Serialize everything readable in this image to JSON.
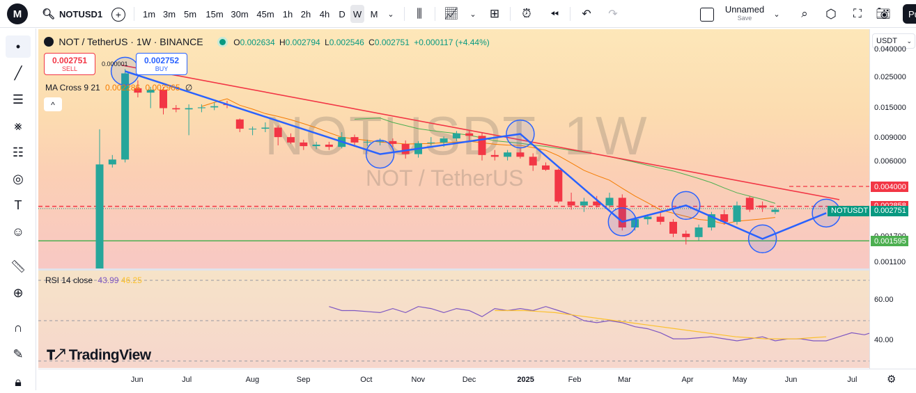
{
  "toolbar": {
    "logo": "M",
    "symbol": "NOTUSD1",
    "intervals": [
      "1m",
      "3m",
      "5m",
      "15m",
      "30m",
      "45m",
      "1h",
      "2h",
      "4h",
      "D",
      "W",
      "M"
    ],
    "active_interval": "W",
    "layout_name": "Unnamed",
    "layout_sub": "Save",
    "publish": "Pu"
  },
  "legend": {
    "title": "NOT / TetherUS · 1W · BINANCE",
    "o_label": "O",
    "o_value": "0.002634",
    "h_label": "H",
    "h_value": "0.002794",
    "l_label": "L",
    "l_value": "0.002546",
    "c_label": "C",
    "c_value": "0.002751",
    "change": "+0.000117 (+4.44%)",
    "sell_price": "0.002751",
    "sell_label": "SELL",
    "buy_price": "0.002752",
    "buy_label": "BUY",
    "spread": "0.000001",
    "ma_label": "MA Cross 9 21",
    "ma_fast": "0.002286",
    "ma_slow": "0.002965",
    "ma_extra": "∅",
    "collapse": "^"
  },
  "watermark": {
    "symbol": "NOTUSDT, 1W",
    "name": "NOT / TetherUS"
  },
  "price_axis": {
    "currency": "USDT",
    "ticks": [
      "0.040000",
      "0.025000",
      "0.015000",
      "0.009000",
      "0.006000",
      "0.002500",
      "0.001700",
      "0.001100"
    ],
    "labels": [
      {
        "text": "0.004000",
        "color": "#f23645"
      },
      {
        "text": "0.002858",
        "color": "#f23645"
      },
      {
        "text": "0.002751",
        "color": "#089981",
        "tag": "NOTUSDT"
      },
      {
        "text": "0.001595",
        "color": "#4caf50"
      }
    ]
  },
  "rsi": {
    "label": "RSI 14 close",
    "value": "43.99",
    "ma_value": "46.25",
    "ticks": [
      "60.00",
      "40.00"
    ]
  },
  "time_axis": [
    "Jun",
    "Jul",
    "Aug",
    "Sep",
    "Oct",
    "Nov",
    "Dec",
    "2025",
    "Feb",
    "Mar",
    "Apr",
    "May",
    "Jun",
    "Jul"
  ],
  "branding": "TradingView",
  "colors": {
    "up": "#26a69a",
    "down": "#f23645",
    "trend": "#2962ff",
    "resistance": "#f23645",
    "support": "#4caf50",
    "ma_fast": "#f57c00",
    "ma_slow": "#4caf50"
  },
  "chart_data": {
    "type": "candlestick",
    "title": "NOT / TetherUS · 1W · BINANCE",
    "y_scale": "log",
    "ylim": [
      0.001,
      0.045
    ],
    "candles": [
      {
        "o": 0.0009,
        "h": 0.0105,
        "l": 0.0009,
        "c": 0.0058
      },
      {
        "o": 0.0058,
        "h": 0.0068,
        "l": 0.0055,
        "c": 0.0063
      },
      {
        "o": 0.0063,
        "h": 0.029,
        "l": 0.006,
        "c": 0.027
      },
      {
        "o": 0.021,
        "h": 0.024,
        "l": 0.018,
        "c": 0.0195
      },
      {
        "o": 0.0195,
        "h": 0.0215,
        "l": 0.015,
        "c": 0.0205
      },
      {
        "o": 0.0205,
        "h": 0.0215,
        "l": 0.0135,
        "c": 0.015
      },
      {
        "o": 0.015,
        "h": 0.0158,
        "l": 0.014,
        "c": 0.0147
      },
      {
        "o": 0.0147,
        "h": 0.016,
        "l": 0.0095,
        "c": 0.015
      },
      {
        "o": 0.015,
        "h": 0.016,
        "l": 0.014,
        "c": 0.0152
      },
      {
        "o": 0.0152,
        "h": 0.0165,
        "l": 0.0145,
        "c": 0.0155
      },
      {
        "o": 0.016,
        "h": 0.017,
        "l": 0.015,
        "c": 0.0158
      },
      {
        "o": 0.0124,
        "h": 0.0126,
        "l": 0.01,
        "c": 0.0106
      },
      {
        "o": 0.0106,
        "h": 0.011,
        "l": 0.0095,
        "c": 0.0106
      },
      {
        "o": 0.0106,
        "h": 0.0118,
        "l": 0.01,
        "c": 0.0108
      },
      {
        "o": 0.0108,
        "h": 0.0112,
        "l": 0.008,
        "c": 0.0092
      },
      {
        "o": 0.0092,
        "h": 0.0098,
        "l": 0.0082,
        "c": 0.0084
      },
      {
        "o": 0.0084,
        "h": 0.0088,
        "l": 0.0074,
        "c": 0.0079
      },
      {
        "o": 0.0079,
        "h": 0.0085,
        "l": 0.0075,
        "c": 0.0081
      },
      {
        "o": 0.0081,
        "h": 0.0085,
        "l": 0.0074,
        "c": 0.0078
      },
      {
        "o": 0.0078,
        "h": 0.01,
        "l": 0.0076,
        "c": 0.0092
      },
      {
        "o": 0.0092,
        "h": 0.0096,
        "l": 0.0078,
        "c": 0.0084
      },
      {
        "o": 0.0084,
        "h": 0.0088,
        "l": 0.0079,
        "c": 0.0085
      },
      {
        "o": 0.0085,
        "h": 0.009,
        "l": 0.008,
        "c": 0.0086
      },
      {
        "o": 0.0086,
        "h": 0.009,
        "l": 0.0078,
        "c": 0.0082
      },
      {
        "o": 0.0082,
        "h": 0.0087,
        "l": 0.0064,
        "c": 0.0069
      },
      {
        "o": 0.0069,
        "h": 0.0086,
        "l": 0.0065,
        "c": 0.0083
      },
      {
        "o": 0.0083,
        "h": 0.0092,
        "l": 0.008,
        "c": 0.0084
      },
      {
        "o": 0.0084,
        "h": 0.0093,
        "l": 0.0078,
        "c": 0.009
      },
      {
        "o": 0.009,
        "h": 0.0102,
        "l": 0.0086,
        "c": 0.0098
      },
      {
        "o": 0.0098,
        "h": 0.0104,
        "l": 0.0086,
        "c": 0.0094
      },
      {
        "o": 0.0094,
        "h": 0.01,
        "l": 0.0062,
        "c": 0.0068
      },
      {
        "o": 0.0068,
        "h": 0.0074,
        "l": 0.0062,
        "c": 0.0066
      },
      {
        "o": 0.0066,
        "h": 0.0074,
        "l": 0.0062,
        "c": 0.0071
      },
      {
        "o": 0.0071,
        "h": 0.0076,
        "l": 0.0064,
        "c": 0.0066
      },
      {
        "o": 0.0066,
        "h": 0.007,
        "l": 0.0052,
        "c": 0.0057
      },
      {
        "o": 0.0057,
        "h": 0.006,
        "l": 0.0052,
        "c": 0.0053
      },
      {
        "o": 0.0053,
        "h": 0.0054,
        "l": 0.003,
        "c": 0.0031
      },
      {
        "o": 0.0031,
        "h": 0.0036,
        "l": 0.0027,
        "c": 0.0029
      },
      {
        "o": 0.0029,
        "h": 0.0033,
        "l": 0.0026,
        "c": 0.0031
      },
      {
        "o": 0.0031,
        "h": 0.0034,
        "l": 0.0028,
        "c": 0.0029
      },
      {
        "o": 0.0029,
        "h": 0.0036,
        "l": 0.0028,
        "c": 0.0033
      },
      {
        "o": 0.0033,
        "h": 0.0035,
        "l": 0.0019,
        "c": 0.002
      },
      {
        "o": 0.002,
        "h": 0.0024,
        "l": 0.0019,
        "c": 0.0023
      },
      {
        "o": 0.0023,
        "h": 0.0025,
        "l": 0.0021,
        "c": 0.0024
      },
      {
        "o": 0.0024,
        "h": 0.0026,
        "l": 0.0021,
        "c": 0.0022
      },
      {
        "o": 0.0022,
        "h": 0.0023,
        "l": 0.0017,
        "c": 0.0018
      },
      {
        "o": 0.0018,
        "h": 0.0019,
        "l": 0.0015,
        "c": 0.0017
      },
      {
        "o": 0.0017,
        "h": 0.0021,
        "l": 0.0016,
        "c": 0.002
      },
      {
        "o": 0.002,
        "h": 0.0026,
        "l": 0.0019,
        "c": 0.0025
      },
      {
        "o": 0.0025,
        "h": 0.0027,
        "l": 0.0021,
        "c": 0.0022
      },
      {
        "o": 0.0022,
        "h": 0.0031,
        "l": 0.0021,
        "c": 0.0029
      },
      {
        "o": 0.0033,
        "h": 0.0034,
        "l": 0.0026,
        "c": 0.0027
      },
      {
        "o": 0.0029,
        "h": 0.0031,
        "l": 0.0026,
        "c": 0.0028
      },
      {
        "o": 0.0026,
        "h": 0.0028,
        "l": 0.0025,
        "c": 0.0027
      }
    ],
    "rsi_values": [
      57,
      55,
      55,
      54.5,
      54,
      56,
      54,
      57,
      56,
      54,
      56,
      55,
      52,
      56,
      55,
      56,
      55,
      57,
      55,
      53,
      50,
      49,
      50,
      49,
      47,
      46,
      44,
      41,
      41,
      41.5,
      42,
      41,
      40,
      41,
      42,
      40,
      41,
      41,
      40,
      40,
      42,
      44,
      43,
      45,
      45,
      44,
      44.5
    ],
    "rsi_ma_values": [
      55,
      55,
      55,
      54.5,
      54,
      53,
      52,
      51,
      50,
      49,
      48,
      47,
      46,
      45,
      44,
      43,
      42,
      41.5,
      41,
      41,
      41,
      41.5,
      42
    ]
  }
}
